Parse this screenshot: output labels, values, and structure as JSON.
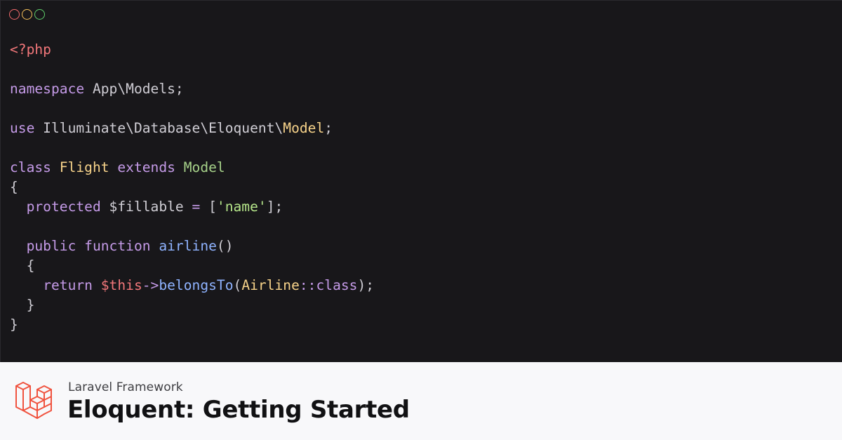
{
  "window": {
    "dots": [
      {
        "name": "close-dot",
        "color": "#f26b6b"
      },
      {
        "name": "minimize-dot",
        "color": "#f5c15a"
      },
      {
        "name": "maximize-dot",
        "color": "#5fcf6b"
      }
    ]
  },
  "syntax_colors": {
    "plain": "#cfcdd4",
    "tag": "#f2777a",
    "keyword": "#c59be8",
    "class": "#f7d38a",
    "type": "#a6d189",
    "string": "#b5e58a",
    "operator": "#c59be8",
    "function": "#8fb3ff",
    "variable": "#f2777a"
  },
  "code_lines": [
    [
      {
        "t": "<?php",
        "c": "tag"
      }
    ],
    [],
    [
      {
        "t": "namespace",
        "c": "keyword"
      },
      {
        "t": " App\\Models;",
        "c": "plain"
      }
    ],
    [],
    [
      {
        "t": "use",
        "c": "keyword"
      },
      {
        "t": " Illuminate\\Database\\Eloquent\\",
        "c": "plain"
      },
      {
        "t": "Model",
        "c": "class"
      },
      {
        "t": ";",
        "c": "plain"
      }
    ],
    [],
    [
      {
        "t": "class",
        "c": "keyword"
      },
      {
        "t": " ",
        "c": "plain"
      },
      {
        "t": "Flight",
        "c": "class"
      },
      {
        "t": " ",
        "c": "plain"
      },
      {
        "t": "extends",
        "c": "keyword"
      },
      {
        "t": " ",
        "c": "plain"
      },
      {
        "t": "Model",
        "c": "type"
      }
    ],
    [
      {
        "t": "{",
        "c": "plain"
      }
    ],
    [
      {
        "t": "  ",
        "c": "plain"
      },
      {
        "t": "protected",
        "c": "keyword"
      },
      {
        "t": " $fillable ",
        "c": "plain"
      },
      {
        "t": "=",
        "c": "operator"
      },
      {
        "t": " [",
        "c": "plain"
      },
      {
        "t": "'name'",
        "c": "string"
      },
      {
        "t": "];",
        "c": "plain"
      }
    ],
    [],
    [
      {
        "t": "  ",
        "c": "plain"
      },
      {
        "t": "public",
        "c": "keyword"
      },
      {
        "t": " ",
        "c": "plain"
      },
      {
        "t": "function",
        "c": "keyword"
      },
      {
        "t": " ",
        "c": "plain"
      },
      {
        "t": "airline",
        "c": "function"
      },
      {
        "t": "()",
        "c": "plain"
      }
    ],
    [
      {
        "t": "  {",
        "c": "plain"
      }
    ],
    [
      {
        "t": "    ",
        "c": "plain"
      },
      {
        "t": "return",
        "c": "keyword"
      },
      {
        "t": " ",
        "c": "plain"
      },
      {
        "t": "$this",
        "c": "variable"
      },
      {
        "t": "->",
        "c": "operator"
      },
      {
        "t": "belongsTo",
        "c": "function"
      },
      {
        "t": "(",
        "c": "plain"
      },
      {
        "t": "Airline",
        "c": "class"
      },
      {
        "t": "::",
        "c": "operator"
      },
      {
        "t": "class",
        "c": "keyword"
      },
      {
        "t": ");",
        "c": "plain"
      }
    ],
    [
      {
        "t": "  }",
        "c": "plain"
      }
    ],
    [
      {
        "t": "}",
        "c": "plain"
      }
    ]
  ],
  "footer": {
    "logo_icon": "laravel-logo-icon",
    "logo_color": "#f0533f",
    "subtitle": "Laravel Framework",
    "title": "Eloquent: Getting Started"
  }
}
